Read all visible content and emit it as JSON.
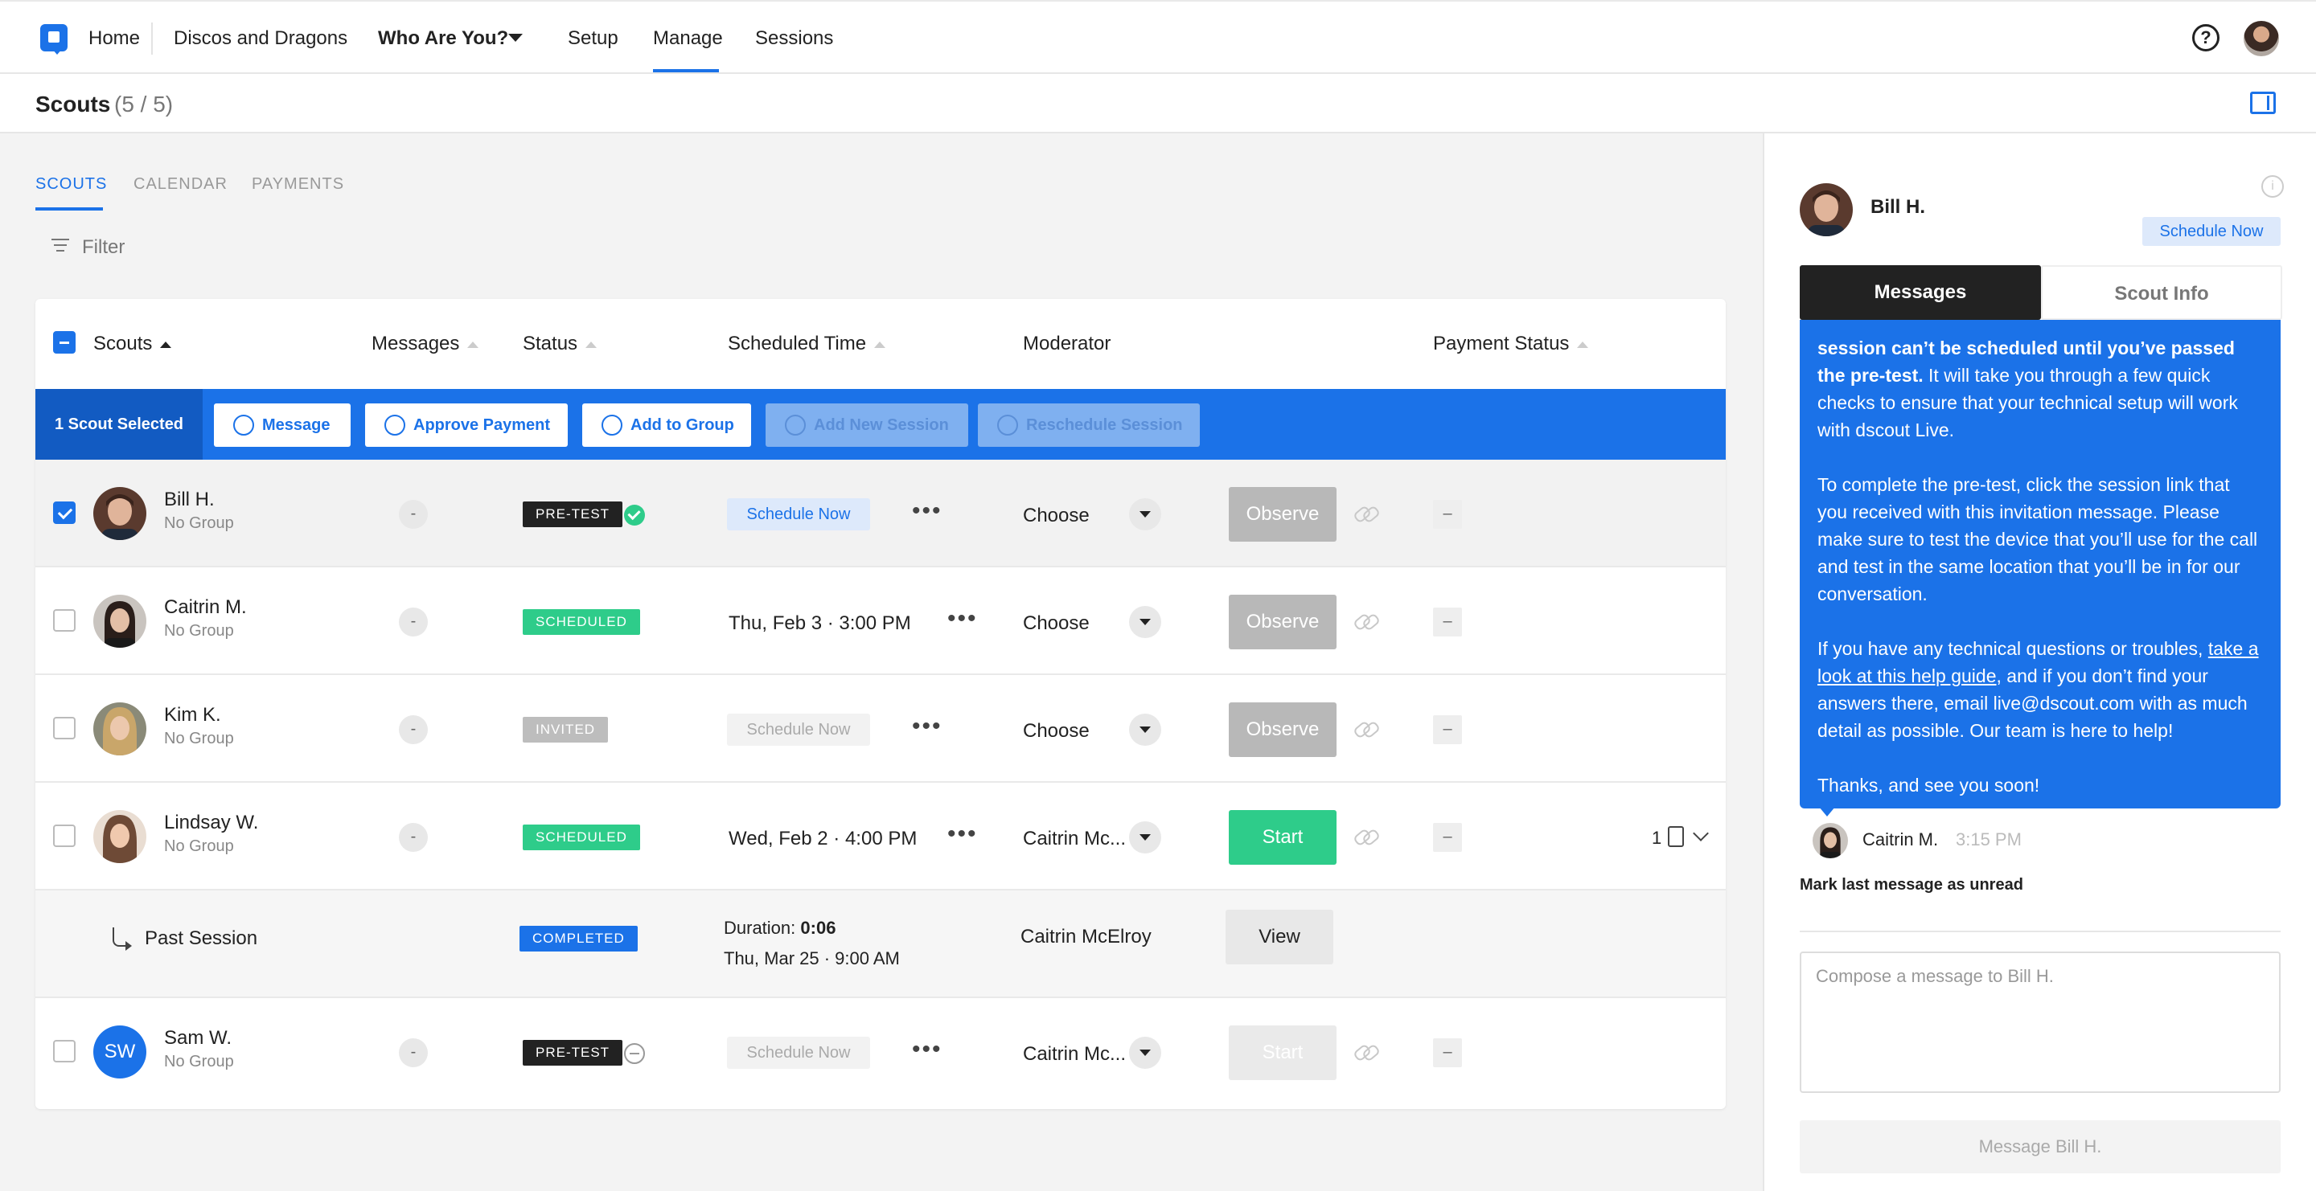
{
  "nav": {
    "home": "Home",
    "project": "Discos and Dragons",
    "mission": "Who Are You?",
    "setup": "Setup",
    "manage": "Manage",
    "sessions": "Sessions",
    "help_glyph": "?"
  },
  "page": {
    "title": "Scouts",
    "count": "(5 / 5)"
  },
  "tabs": [
    "SCOUTS",
    "CALENDAR",
    "PAYMENTS"
  ],
  "filter_label": "Filter",
  "table": {
    "headers": {
      "scouts": "Scouts",
      "messages": "Messages",
      "status": "Status",
      "scheduled_time": "Scheduled Time",
      "moderator": "Moderator",
      "payment_status": "Payment Status"
    },
    "selection": {
      "label": "1 Scout Selected",
      "buttons": [
        "Message",
        "Approve Payment",
        "Add to Group",
        "Add New Session",
        "Reschedule Session"
      ]
    },
    "rows": [
      {
        "name": "Bill H.",
        "group": "No Group",
        "messages": "-",
        "status": "PRE-TEST",
        "scheduled": "Schedule Now",
        "moderator": "Choose",
        "action": "Observe",
        "payment": "–"
      },
      {
        "name": "Caitrin M.",
        "group": "No Group",
        "messages": "-",
        "status": "SCHEDULED",
        "scheduled": "Thu, Feb 3 · 3:00 PM",
        "moderator": "Choose",
        "action": "Observe",
        "payment": "–"
      },
      {
        "name": "Kim K.",
        "group": "No Group",
        "messages": "-",
        "status": "INVITED",
        "scheduled": "Schedule Now",
        "moderator": "Choose",
        "action": "Observe",
        "payment": "–"
      },
      {
        "name": "Lindsay W.",
        "group": "No Group",
        "messages": "-",
        "status": "SCHEDULED",
        "scheduled": "Wed, Feb 2 · 4:00 PM",
        "moderator": "Caitrin Mc...",
        "action": "Start",
        "payment": "–",
        "unread": "1"
      },
      {
        "initials": "SW",
        "name": "Sam W.",
        "group": "No Group",
        "messages": "-",
        "status": "PRE-TEST",
        "scheduled": "Schedule Now",
        "moderator": "Caitrin Mc...",
        "action": "Start",
        "payment": "–"
      }
    ],
    "past_session": {
      "label": "Past Session",
      "status": "COMPLETED",
      "duration_label": "Duration:",
      "duration": "0:06",
      "time": "Thu, Mar 25 · 9:00 AM",
      "moderator": "Caitrin McElroy",
      "action": "View"
    }
  },
  "panel": {
    "name": "Bill H.",
    "schedule_now": "Schedule Now",
    "info_glyph": "i",
    "tabs": {
      "messages": "Messages",
      "scout_info": "Scout Info"
    },
    "message": {
      "p1_bold": "session can’t be scheduled until you’ve passed the pre-test.",
      "p1_rest": " It will take you through a few quick checks to ensure that your technical setup will work with dscout Live.",
      "p2": "To complete the pre-test, click the session link that you received with this invitation message. Please make sure to test the device that you’ll use for the call and test in the same location that you’ll be in for our conversation.",
      "p3_a": "If you have any technical questions or troubles, ",
      "p3_link": "take a look at this help guide",
      "p3_b": ", and if you don’t find your answers there, email live@dscout.com with as much detail as possible. Our team is here to help!",
      "p4": "Thanks, and see you soon!"
    },
    "sender": "Caitrin M.",
    "sent_time": "3:15 PM",
    "mark_unread": "Mark last message as unread",
    "compose_placeholder": "Compose a message to Bill H.",
    "send_button": "Message Bill H."
  },
  "colors": {
    "brand_blue": "#1b72e8",
    "scheduled_green": "#2ecc8a",
    "pretest_black": "#222222",
    "invited_gray": "#bdbdbd"
  },
  "icons": [
    "logo-icon",
    "caret-down-icon",
    "help-icon",
    "panel-toggle-icon",
    "filter-icon",
    "sort-icon",
    "checkbox-icon",
    "chat-icon",
    "dollar-icon",
    "group-icon",
    "plus-circle-icon",
    "clock-icon",
    "check-circle-icon",
    "minus-circle-icon",
    "more-dots-icon",
    "link-icon",
    "unread-message-icon",
    "chevron-down-icon",
    "info-icon"
  ]
}
